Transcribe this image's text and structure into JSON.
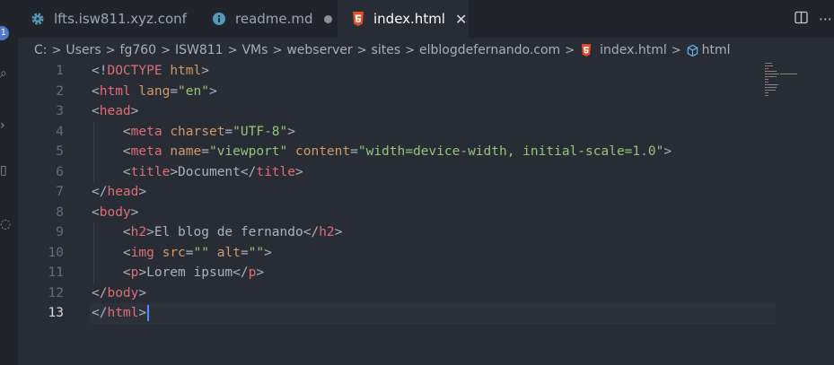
{
  "tabs": [
    {
      "label": "lfts.isw811.xyz.conf",
      "icon": "gear-icon",
      "icon_color": "#519aba"
    },
    {
      "label": "readme.md",
      "icon": "info-icon",
      "icon_color": "#519aba",
      "modified": true
    },
    {
      "label": "index.html",
      "icon": "html5-icon",
      "icon_color": "#e44d26",
      "active": true
    }
  ],
  "activity_badge": "1",
  "breadcrumb": {
    "parts": [
      "C:",
      "Users",
      "fg760",
      "ISW811",
      "VMs",
      "webserver",
      "sites",
      "elblogdefernando.com"
    ],
    "file": "index.html",
    "symbol": "html"
  },
  "editor": {
    "line_numbers": [
      "1",
      "2",
      "3",
      "4",
      "5",
      "6",
      "7",
      "8",
      "9",
      "10",
      "11",
      "12",
      "13"
    ],
    "current_line": 13,
    "lines": [
      [
        {
          "c": "p",
          "t": "<!"
        },
        {
          "c": "t",
          "t": "DOCTYPE"
        },
        {
          "c": "p",
          "t": " "
        },
        {
          "c": "a",
          "t": "html"
        },
        {
          "c": "p",
          "t": ">"
        }
      ],
      [
        {
          "c": "p",
          "t": "<"
        },
        {
          "c": "t",
          "t": "html"
        },
        {
          "c": "p",
          "t": " "
        },
        {
          "c": "a",
          "t": "lang"
        },
        {
          "c": "p",
          "t": "="
        },
        {
          "c": "s",
          "t": "\"en\""
        },
        {
          "c": "p",
          "t": ">"
        }
      ],
      [
        {
          "c": "p",
          "t": "<"
        },
        {
          "c": "t",
          "t": "head"
        },
        {
          "c": "p",
          "t": ">"
        }
      ],
      [
        {
          "c": "p",
          "t": "    <"
        },
        {
          "c": "t",
          "t": "meta"
        },
        {
          "c": "p",
          "t": " "
        },
        {
          "c": "a",
          "t": "charset"
        },
        {
          "c": "p",
          "t": "="
        },
        {
          "c": "s",
          "t": "\"UTF-8\""
        },
        {
          "c": "p",
          "t": ">"
        }
      ],
      [
        {
          "c": "p",
          "t": "    <"
        },
        {
          "c": "t",
          "t": "meta"
        },
        {
          "c": "p",
          "t": " "
        },
        {
          "c": "a",
          "t": "name"
        },
        {
          "c": "p",
          "t": "="
        },
        {
          "c": "s",
          "t": "\"viewport\""
        },
        {
          "c": "p",
          "t": " "
        },
        {
          "c": "a",
          "t": "content"
        },
        {
          "c": "p",
          "t": "="
        },
        {
          "c": "s",
          "t": "\"width=device-width, initial-scale=1.0\""
        },
        {
          "c": "p",
          "t": ">"
        }
      ],
      [
        {
          "c": "p",
          "t": "    <"
        },
        {
          "c": "t",
          "t": "title"
        },
        {
          "c": "p",
          "t": ">Document</"
        },
        {
          "c": "t",
          "t": "title"
        },
        {
          "c": "p",
          "t": ">"
        }
      ],
      [
        {
          "c": "p",
          "t": "</"
        },
        {
          "c": "t",
          "t": "head"
        },
        {
          "c": "p",
          "t": ">"
        }
      ],
      [
        {
          "c": "p",
          "t": "<"
        },
        {
          "c": "t",
          "t": "body"
        },
        {
          "c": "p",
          "t": ">"
        }
      ],
      [
        {
          "c": "p",
          "t": "    <"
        },
        {
          "c": "t",
          "t": "h2"
        },
        {
          "c": "p",
          "t": ">El blog de fernando</"
        },
        {
          "c": "t",
          "t": "h2"
        },
        {
          "c": "p",
          "t": ">"
        }
      ],
      [
        {
          "c": "p",
          "t": "    <"
        },
        {
          "c": "t",
          "t": "img"
        },
        {
          "c": "p",
          "t": " "
        },
        {
          "c": "a",
          "t": "src"
        },
        {
          "c": "p",
          "t": "="
        },
        {
          "c": "s",
          "t": "\"\""
        },
        {
          "c": "p",
          "t": " "
        },
        {
          "c": "a",
          "t": "alt"
        },
        {
          "c": "p",
          "t": "="
        },
        {
          "c": "s",
          "t": "\"\""
        },
        {
          "c": "p",
          "t": ">"
        }
      ],
      [
        {
          "c": "p",
          "t": "    <"
        },
        {
          "c": "t",
          "t": "p"
        },
        {
          "c": "p",
          "t": ">Lorem ipsum</"
        },
        {
          "c": "t",
          "t": "p"
        },
        {
          "c": "p",
          "t": ">"
        }
      ],
      [
        {
          "c": "p",
          "t": "</"
        },
        {
          "c": "t",
          "t": "body"
        },
        {
          "c": "p",
          "t": ">"
        }
      ],
      [
        {
          "c": "p",
          "t": "</"
        },
        {
          "c": "t",
          "t": "html"
        },
        {
          "c": "p",
          "t": ">"
        }
      ]
    ]
  },
  "colors": {
    "editor_bg": "#282c34",
    "tag": "#e06c75",
    "attribute": "#d19a66",
    "string": "#98c379",
    "punctuation": "#abb2bf",
    "cursor": "#528bff"
  }
}
